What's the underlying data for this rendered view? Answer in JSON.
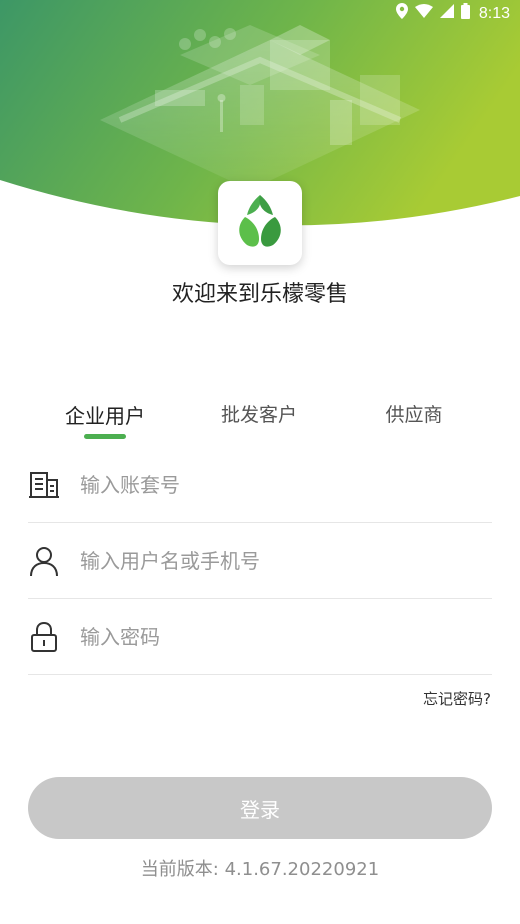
{
  "status_bar": {
    "time": "8:13"
  },
  "welcome_text": "欢迎来到乐檬零售",
  "tabs": [
    {
      "label": "企业用户",
      "active": true
    },
    {
      "label": "批发客户",
      "active": false
    },
    {
      "label": "供应商",
      "active": false
    }
  ],
  "form": {
    "account_placeholder": "输入账套号",
    "username_placeholder": "输入用户名或手机号",
    "password_placeholder": "输入密码",
    "forgot_label": "忘记密码?"
  },
  "login_label": "登录",
  "version_text": "当前版本: 4.1.67.20220921",
  "colors": {
    "brand_green": "#4caf50",
    "hero_left": "#3f9a66",
    "hero_right": "#a2c836",
    "button_disabled": "#c8c8c8"
  },
  "icons": [
    "location-icon",
    "wifi-icon",
    "signal-icon",
    "battery-icon",
    "building-icon",
    "user-icon",
    "lock-icon",
    "leaf-logo-icon"
  ]
}
